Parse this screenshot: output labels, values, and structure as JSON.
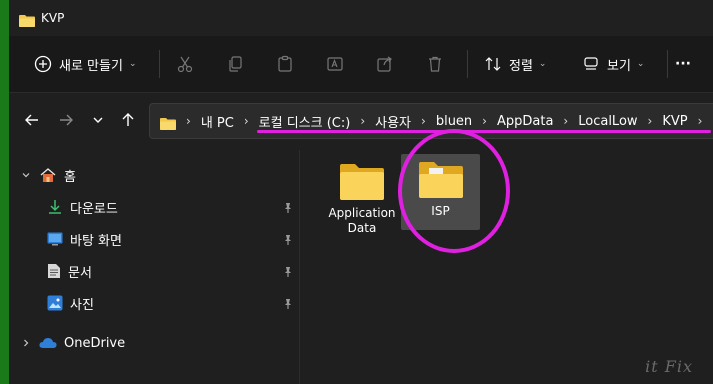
{
  "window": {
    "title": "KVP"
  },
  "toolbar": {
    "new_label": "새로 만들기",
    "sort_label": "정렬",
    "view_label": "보기",
    "more_label": "···"
  },
  "address": {
    "crumbs": [
      "내 PC",
      "로컬 디스크 (C:)",
      "사용자",
      "bluen",
      "AppData",
      "LocalLow",
      "KVP"
    ]
  },
  "sidebar": {
    "home": "홈",
    "items": [
      {
        "label": "다운로드",
        "icon": "download-icon"
      },
      {
        "label": "바탕 화면",
        "icon": "desktop-icon"
      },
      {
        "label": "문서",
        "icon": "document-icon"
      },
      {
        "label": "사진",
        "icon": "pictures-icon"
      }
    ],
    "onedrive": "OneDrive"
  },
  "content": {
    "files": [
      {
        "name": "Application Data",
        "selected": false
      },
      {
        "name": "ISP",
        "selected": true
      }
    ]
  },
  "watermark": "it Fix",
  "colors": {
    "folder": "#f2c94c",
    "highlight": "#e020e0",
    "onedrive": "#2f7fd8"
  }
}
